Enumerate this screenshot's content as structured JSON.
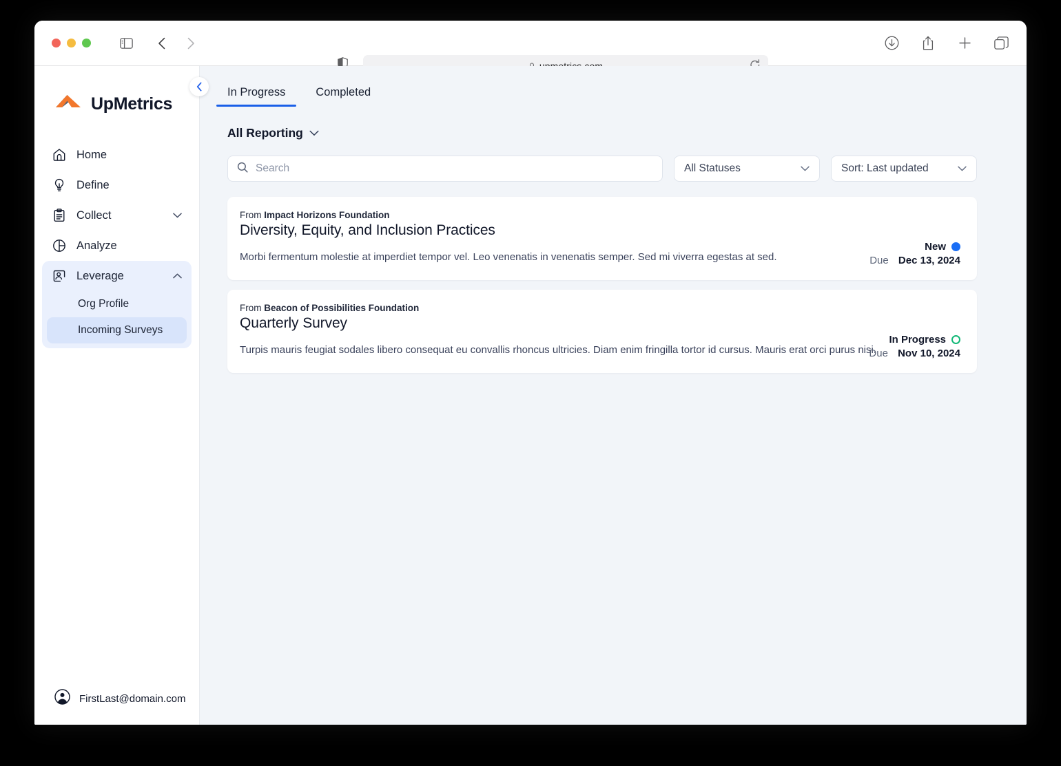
{
  "browser": {
    "url": "upmetrics.com",
    "traffic_lights": [
      "close",
      "minimize",
      "maximize"
    ],
    "icons": {
      "sidebar_toggle": "sidebar-toggle-icon",
      "back": "back-arrow-icon",
      "forward": "forward-arrow-icon",
      "shield": "privacy-shield-icon",
      "lock": "lock-icon",
      "reload": "reload-icon",
      "download": "download-icon",
      "share": "share-icon",
      "new_tab": "plus-icon",
      "tab_overview": "tab-overview-icon"
    }
  },
  "sidebar": {
    "brand": "UpMetrics",
    "collapse_label": "‹",
    "items": [
      {
        "label": "Home",
        "icon": "home-icon",
        "expandable": false
      },
      {
        "label": "Define",
        "icon": "lightbulb-icon",
        "expandable": false
      },
      {
        "label": "Collect",
        "icon": "clipboard-icon",
        "expandable": true,
        "expanded": false
      },
      {
        "label": "Analyze",
        "icon": "pie-chart-icon",
        "expandable": false
      },
      {
        "label": "Leverage",
        "icon": "user-card-icon",
        "expandable": true,
        "expanded": true
      }
    ],
    "leverage_children": [
      {
        "label": "Org Profile",
        "active": false
      },
      {
        "label": "Incoming Surveys",
        "active": true
      }
    ],
    "footer": {
      "email": "FirstLast@domain.com",
      "avatar_icon": "user-avatar-icon"
    }
  },
  "main": {
    "tabs": [
      {
        "label": "In Progress",
        "active": true
      },
      {
        "label": "Completed",
        "active": false
      }
    ],
    "reporting_filter": {
      "label": "All Reporting",
      "chevron": "chevron-down-icon"
    },
    "search": {
      "placeholder": "Search",
      "value": "",
      "icon": "search-icon"
    },
    "status_filter": {
      "value": "All Statuses",
      "chevron": "chevron-down-icon"
    },
    "sort_filter": {
      "value": "Sort: Last updated",
      "chevron": "chevron-down-icon"
    },
    "due_label": "Due",
    "from_label": "From",
    "cards": [
      {
        "from": "Impact Horizons Foundation",
        "title": "Diversity, Equity, and Inclusion Practices",
        "body": "Morbi fermentum molestie at imperdiet tempor vel. Leo venenatis in venenatis semper. Sed mi viverra egestas at sed.",
        "status": "New",
        "status_style": "filled",
        "status_color": "#1a6ef5",
        "due_date": "Dec 13, 2024"
      },
      {
        "from": "Beacon of Possibilities Foundation",
        "title": "Quarterly Survey",
        "body": "Turpis mauris feugiat sodales libero consequat eu convallis rhoncus ultricies. Diam enim fringilla tortor id cursus. Mauris erat orci purus nisi.",
        "status": "In Progress",
        "status_style": "hollow",
        "status_color": "#13b877",
        "due_date": "Nov 10, 2024"
      }
    ]
  },
  "colors": {
    "accent_blue": "#1a5fe8",
    "page_bg": "#f2f5f9",
    "sidebar_group_bg": "#eaf0fd",
    "sidebar_active_bg": "#d8e4fb",
    "brand_orange": "#f2772c",
    "brand_slate": "#5b6472"
  }
}
